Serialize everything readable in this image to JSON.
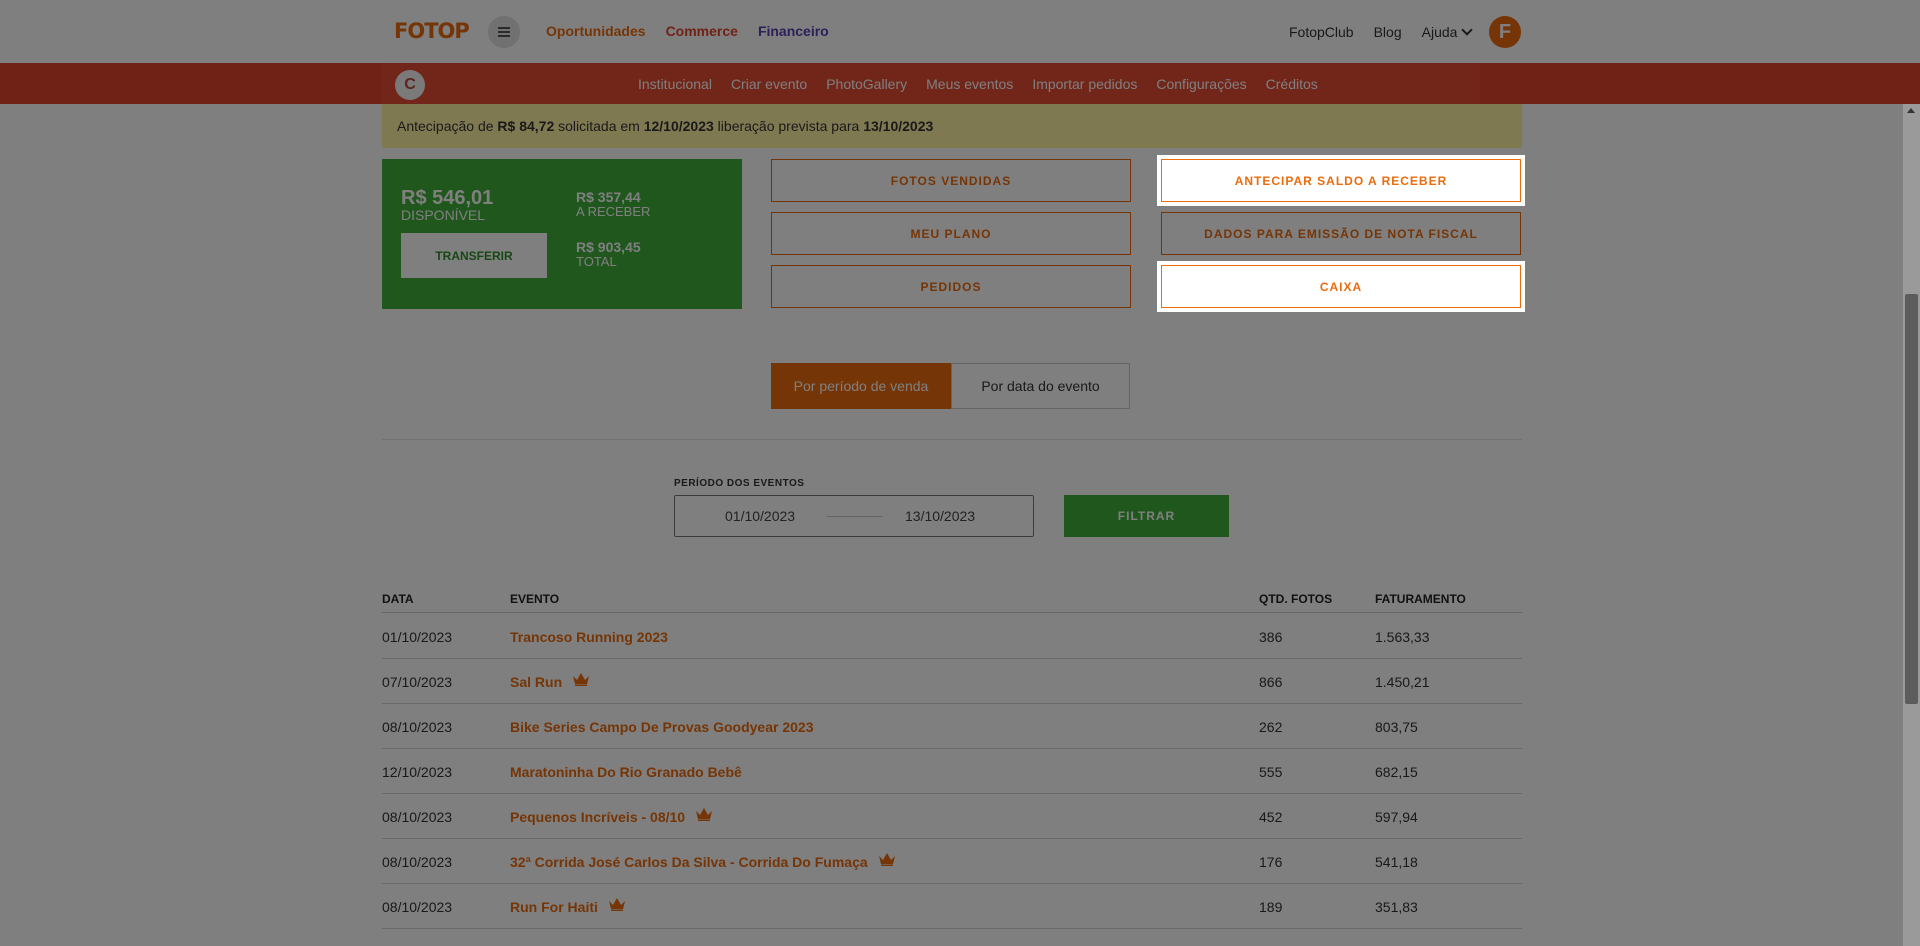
{
  "header": {
    "logo": "FOTOP",
    "nav": [
      {
        "label": "Oportunidades",
        "color": "#ec6b0c"
      },
      {
        "label": "Commerce",
        "color": "#e0442e"
      },
      {
        "label": "Financeiro",
        "color": "#5b3fb0"
      }
    ],
    "right_links": [
      "FotopClub",
      "Blog",
      "Ajuda"
    ],
    "avatar_letter": "F"
  },
  "subnav": {
    "avatar_letter": "C",
    "items": [
      "Institucional",
      "Criar evento",
      "PhotoGallery",
      "Meus eventos",
      "Importar pedidos",
      "Configurações",
      "Créditos"
    ]
  },
  "notice": {
    "pre": "Antecipação de ",
    "amount": "R$ 84,72",
    "mid": " solicitada em ",
    "date_requested": "12/10/2023",
    "mid2": " liberação prevista para ",
    "date_release": "13/10/2023"
  },
  "balance": {
    "available_value": "R$ 546,01",
    "available_label": "DISPONÍVEL",
    "receivable_value": "R$ 357,44",
    "receivable_label": "A RECEBER",
    "total_value": "R$ 903,45",
    "total_label": "TOTAL",
    "transfer_label": "TRANSFERIR"
  },
  "actions": {
    "fotos_vendidas": "FOTOS VENDIDAS",
    "meu_plano": "MEU PLANO",
    "pedidos": "PEDIDOS",
    "antecipar": "ANTECIPAR SALDO A RECEBER",
    "dados_nf": "DADOS PARA EMISSÃO DE NOTA FISCAL",
    "caixa": "CAIXA"
  },
  "tabs": {
    "by_sale": "Por período de venda",
    "by_event": "Por data do evento"
  },
  "filter": {
    "label": "PERÍODO DOS EVENTOS",
    "start": "01/10/2023",
    "end": "13/10/2023",
    "button": "FILTRAR"
  },
  "table": {
    "headers": {
      "date": "DATA",
      "event": "EVENTO",
      "qty": "QTD. FOTOS",
      "revenue": "FATURAMENTO"
    },
    "rows": [
      {
        "date": "01/10/2023",
        "event": "Trancoso Running 2023",
        "qty": "386",
        "revenue": "1.563,33",
        "crown": false
      },
      {
        "date": "07/10/2023",
        "event": "Sal Run",
        "qty": "866",
        "revenue": "1.450,21",
        "crown": true
      },
      {
        "date": "08/10/2023",
        "event": "Bike Series Campo De Provas Goodyear 2023",
        "qty": "262",
        "revenue": "803,75",
        "crown": false
      },
      {
        "date": "12/10/2023",
        "event": "Maratoninha Do Rio Granado Bebê",
        "qty": "555",
        "revenue": "682,15",
        "crown": false
      },
      {
        "date": "08/10/2023",
        "event": "Pequenos Incríveis - 08/10",
        "qty": "452",
        "revenue": "597,94",
        "crown": true
      },
      {
        "date": "08/10/2023",
        "event": "32ª Corrida José Carlos Da Silva - Corrida Do Fumaça",
        "qty": "176",
        "revenue": "541,18",
        "crown": true
      },
      {
        "date": "08/10/2023",
        "event": "Run For Haiti",
        "qty": "189",
        "revenue": "351,83",
        "crown": true
      }
    ]
  },
  "colors": {
    "brand_orange": "#ec6b0c",
    "brand_red": "#e0442e",
    "success_green": "#3fae3b",
    "notice_yellow": "#fff2a4"
  }
}
